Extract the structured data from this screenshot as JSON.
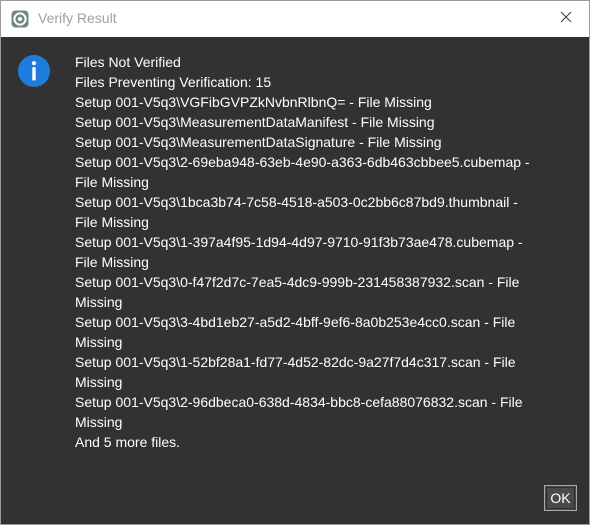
{
  "window": {
    "title": "Verify Result",
    "app_icon": "app-logo-icon",
    "close_icon": "close-icon"
  },
  "dialog": {
    "icon": "info-icon",
    "lines": [
      "Files Not Verified",
      "Files Preventing Verification: 15",
      "Setup 001-V5q3\\VGFibGVPZkNvbnRlbnQ= - File Missing",
      "Setup 001-V5q3\\MeasurementDataManifest - File Missing",
      "Setup 001-V5q3\\MeasurementDataSignature - File Missing",
      "Setup 001-V5q3\\2-69eba948-63eb-4e90-a363-6db463cbbee5.cubemap -",
      "File Missing",
      "Setup 001-V5q3\\1bca3b74-7c58-4518-a503-0c2bb6c87bd9.thumbnail -",
      "File Missing",
      "Setup 001-V5q3\\1-397a4f95-1d94-4d97-9710-91f3b73ae478.cubemap -",
      "File Missing",
      "Setup 001-V5q3\\0-f47f2d7c-7ea5-4dc9-999b-231458387932.scan - File",
      "Missing",
      "Setup 001-V5q3\\3-4bd1eb27-a5d2-4bff-9ef6-8a0b253e4cc0.scan - File",
      "Missing",
      "Setup 001-V5q3\\1-52bf28a1-fd77-4d52-82dc-9a27f7d4c317.scan - File",
      "Missing",
      "Setup 001-V5q3\\2-96dbeca0-638d-4834-bbc8-cefa88076832.scan - File",
      "Missing",
      "And 5 more files."
    ],
    "ok_label": "OK"
  },
  "colors": {
    "background": "#323232",
    "titlebar": "#ffffff",
    "info_blue": "#1e7ddc",
    "text": "#ffffff"
  }
}
